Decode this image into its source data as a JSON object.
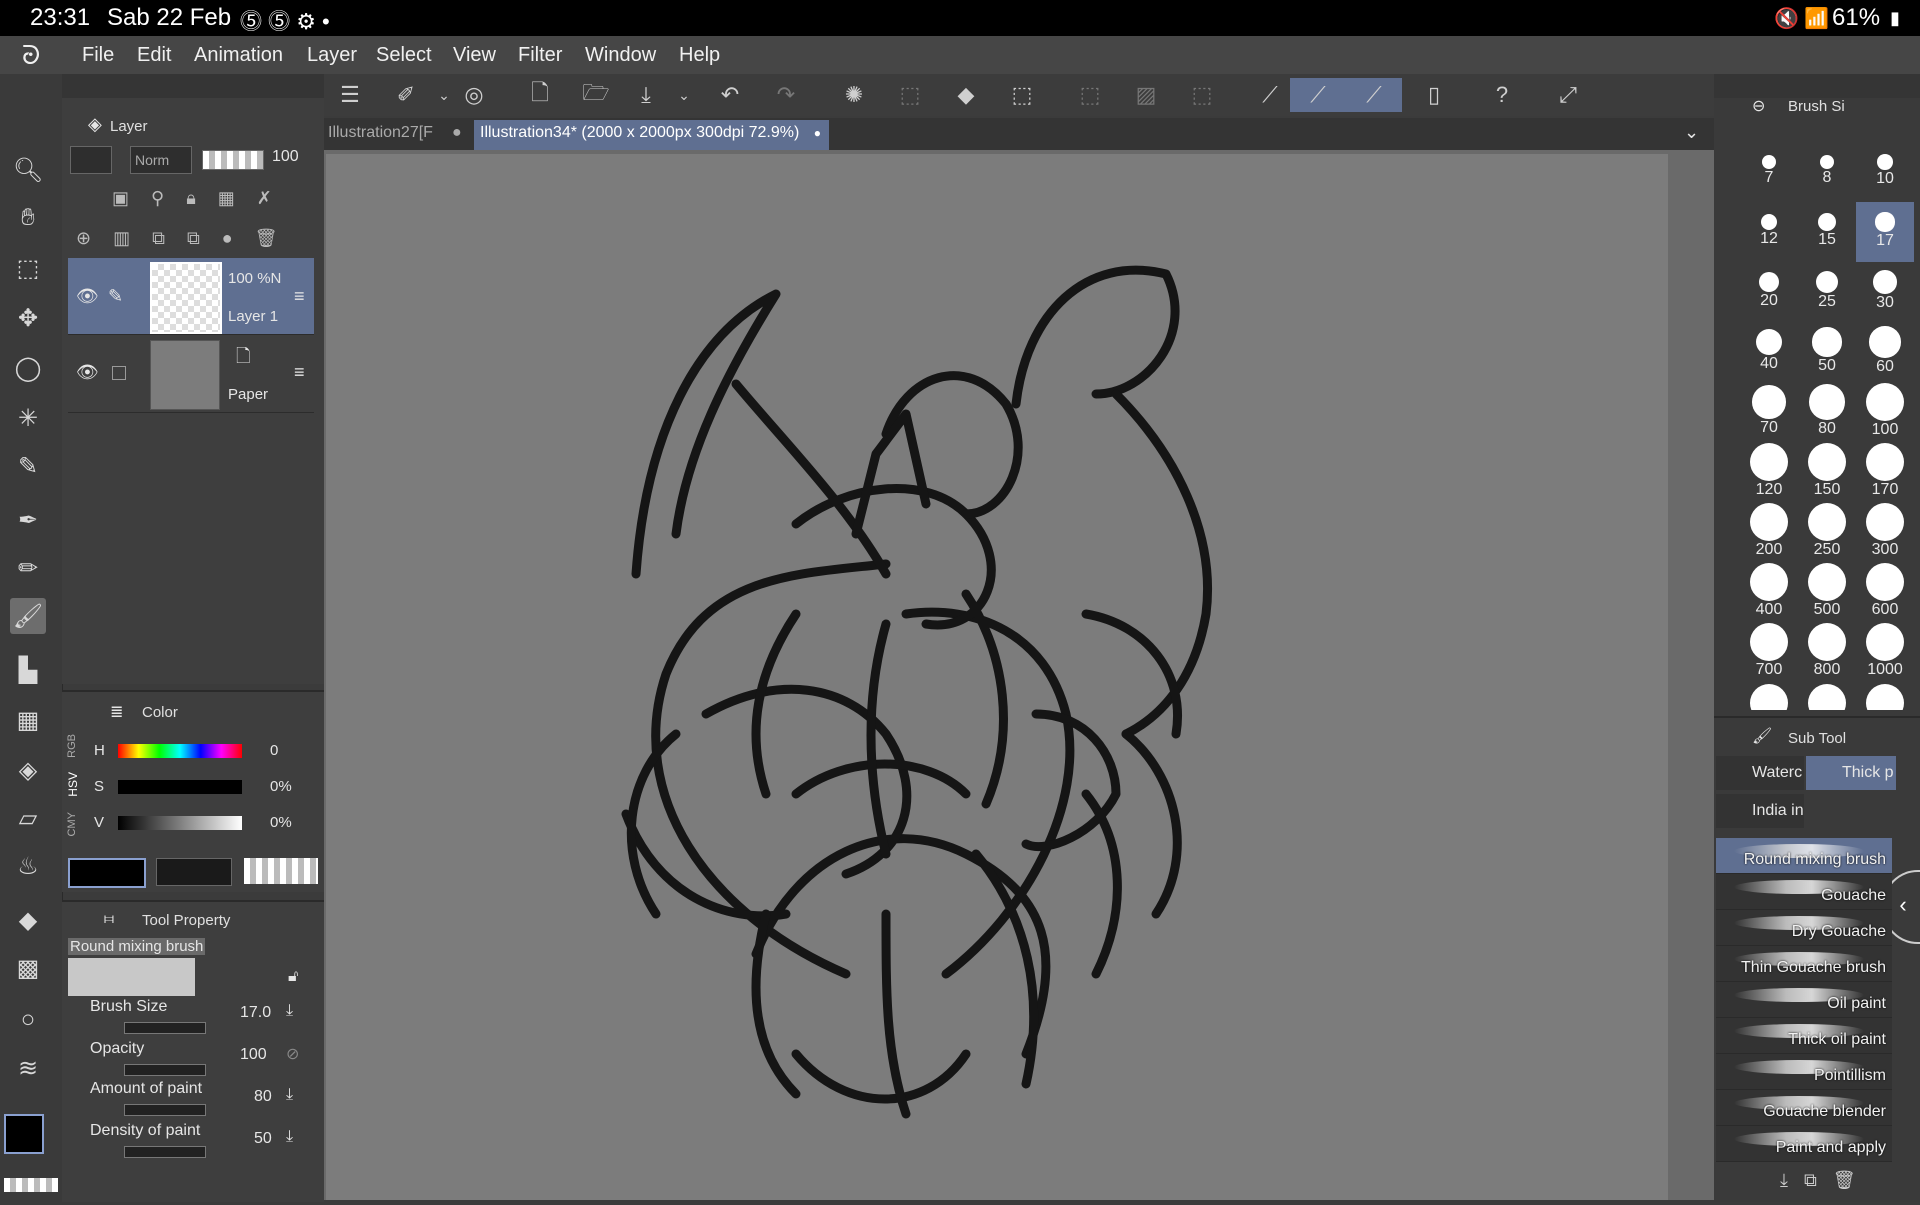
{
  "status": {
    "time": "23:31",
    "date": "Sab 22 Feb",
    "battery": "61%"
  },
  "menu": [
    "File",
    "Edit",
    "Animation",
    "Layer",
    "Select",
    "View",
    "Filter",
    "Window",
    "Help"
  ],
  "tabs": [
    {
      "label": "Illustration27[F"
    },
    {
      "label": "Illustration34* (2000 x 2000px 300dpi 72.9%)"
    }
  ],
  "layer_panel": {
    "title": "Layer",
    "blend": "Norm",
    "opacity": "100",
    "layers": [
      {
        "opacity": "100 %N",
        "name": "Layer 1"
      },
      {
        "opacity": "",
        "name": "Paper"
      }
    ]
  },
  "color_panel": {
    "title": "Color",
    "modes": [
      "RGB",
      "HSV",
      "CMY"
    ],
    "h_label": "H",
    "h_value": "0",
    "s_label": "S",
    "s_value": "0%",
    "v_label": "V",
    "v_value": "0%"
  },
  "tool_property": {
    "title": "Tool Property",
    "brush_name": "Round mixing brush",
    "props": [
      {
        "label": "Brush Size",
        "value": "17.0"
      },
      {
        "label": "Opacity",
        "value": "100"
      },
      {
        "label": "Amount of paint",
        "value": "80"
      },
      {
        "label": "Density of paint",
        "value": "50"
      }
    ]
  },
  "brush_size_panel": {
    "title": "Brush Si",
    "sizes": [
      "7",
      "8",
      "10",
      "12",
      "15",
      "17",
      "20",
      "25",
      "30",
      "40",
      "50",
      "60",
      "70",
      "80",
      "100",
      "120",
      "150",
      "170",
      "200",
      "250",
      "300",
      "400",
      "500",
      "600",
      "700",
      "800",
      "1000"
    ],
    "selected": "17"
  },
  "subtool_panel": {
    "title": "Sub Tool",
    "groups": [
      "Waterc",
      "Thick p",
      "India in"
    ],
    "brushes": [
      "Round mixing brush",
      "Gouache",
      "Dry Gouache",
      "Thin Gouache brush",
      "Oil paint",
      "Thick oil paint",
      "Pointillism",
      "Gouache blender",
      "Paint and apply"
    ]
  },
  "colors": {
    "accent": "#5f6f91",
    "canvas": "#7c7c7c",
    "ui_dark": "#3a3a3a"
  }
}
